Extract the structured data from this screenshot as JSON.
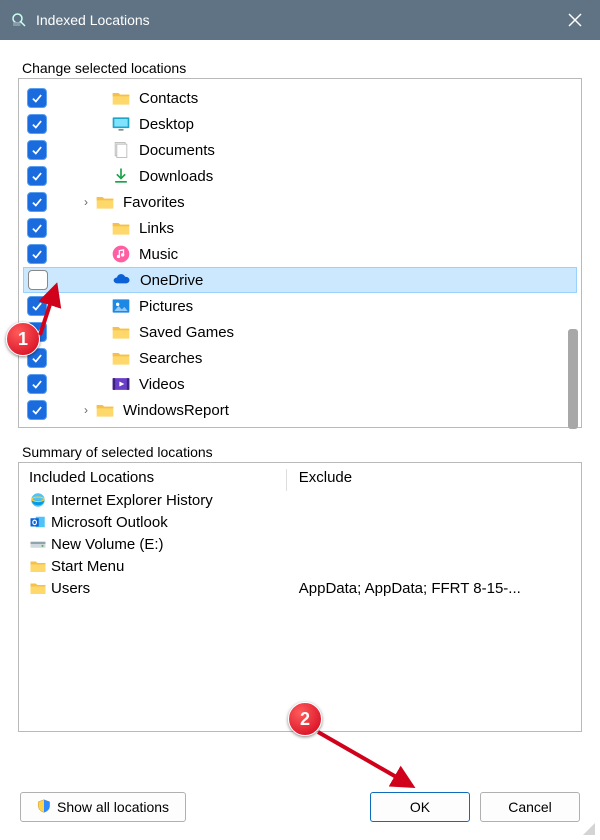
{
  "window": {
    "title": "Indexed Locations"
  },
  "labels": {
    "change": "Change selected locations",
    "summary": "Summary of selected locations",
    "included": "Included Locations",
    "exclude": "Exclude"
  },
  "tree": [
    {
      "label": "Contacts",
      "checked": true,
      "icon": "folder",
      "indent": 70,
      "expander": ""
    },
    {
      "label": "Desktop",
      "checked": true,
      "icon": "desktop",
      "indent": 70,
      "expander": ""
    },
    {
      "label": "Documents",
      "checked": true,
      "icon": "document",
      "indent": 70,
      "expander": ""
    },
    {
      "label": "Downloads",
      "checked": true,
      "icon": "download",
      "indent": 70,
      "expander": ""
    },
    {
      "label": "Favorites",
      "checked": true,
      "icon": "folder",
      "indent": 54,
      "expander": "›"
    },
    {
      "label": "Links",
      "checked": true,
      "icon": "folder",
      "indent": 70,
      "expander": ""
    },
    {
      "label": "Music",
      "checked": true,
      "icon": "music",
      "indent": 70,
      "expander": ""
    },
    {
      "label": "OneDrive",
      "checked": false,
      "icon": "onedrive",
      "indent": 70,
      "expander": "",
      "selected": true
    },
    {
      "label": "Pictures",
      "checked": true,
      "icon": "pictures",
      "indent": 70,
      "expander": ""
    },
    {
      "label": "Saved Games",
      "checked": true,
      "icon": "folder",
      "indent": 70,
      "expander": ""
    },
    {
      "label": "Searches",
      "checked": true,
      "icon": "folder",
      "indent": 70,
      "expander": ""
    },
    {
      "label": "Videos",
      "checked": true,
      "icon": "videos",
      "indent": 70,
      "expander": ""
    },
    {
      "label": "WindowsReport",
      "checked": true,
      "icon": "folder",
      "indent": 54,
      "expander": "›"
    }
  ],
  "included": [
    {
      "label": "Internet Explorer History",
      "icon": "ie"
    },
    {
      "label": "Microsoft Outlook",
      "icon": "outlook"
    },
    {
      "label": "New Volume (E:)",
      "icon": "drive"
    },
    {
      "label": "Start Menu",
      "icon": "folder"
    },
    {
      "label": "Users",
      "icon": "folder"
    }
  ],
  "exclude_rows": [
    "",
    "",
    "",
    "",
    "AppData; AppData; FFRT 8-15-..."
  ],
  "buttons": {
    "show_all": "Show all locations",
    "ok": "OK",
    "cancel": "Cancel"
  },
  "callouts": {
    "one": "1",
    "two": "2"
  }
}
